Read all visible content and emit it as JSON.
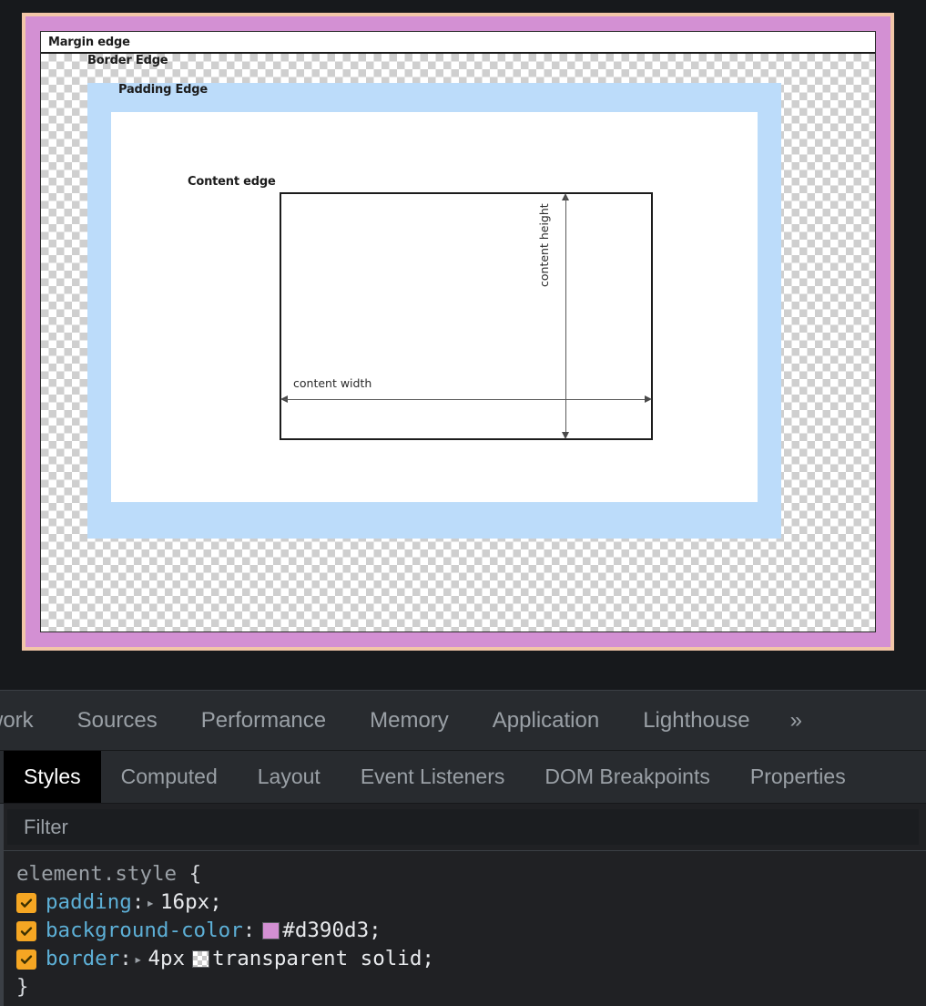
{
  "page": {
    "diagram": {
      "title": "CSS box model diagram",
      "labels": {
        "margin_edge": "Margin edge",
        "border_edge": "Border Edge",
        "padding_edge": "Padding Edge",
        "content_edge": "Content edge",
        "content_width": "content width",
        "content_height": "content height"
      },
      "colors": {
        "element_background": "#d390d3",
        "element_border": "#f2c6a8",
        "padding_region": "#bcdcfa",
        "content_region": "#ffffff",
        "margin_region": "transparent-checkerboard",
        "outline": "#1c1c1c"
      }
    }
  },
  "devtools": {
    "main_tabs": [
      {
        "label": "work",
        "active": false,
        "truncated": true
      },
      {
        "label": "Sources",
        "active": false
      },
      {
        "label": "Performance",
        "active": false
      },
      {
        "label": "Memory",
        "active": false
      },
      {
        "label": "Application",
        "active": false
      },
      {
        "label": "Lighthouse",
        "active": false
      }
    ],
    "overflow_label": "»",
    "sidebar_tabs": [
      {
        "label": "Styles",
        "active": true
      },
      {
        "label": "Computed",
        "active": false
      },
      {
        "label": "Layout",
        "active": false
      },
      {
        "label": "Event Listeners",
        "active": false
      },
      {
        "label": "DOM Breakpoints",
        "active": false
      },
      {
        "label": "Properties",
        "active": false
      }
    ],
    "filter": {
      "placeholder": "Filter",
      "value": ""
    },
    "styles": {
      "selector": "element.style",
      "open_brace": "{",
      "close_brace": "}",
      "declarations": [
        {
          "enabled": true,
          "name": "padding",
          "colon": ":",
          "expandable": true,
          "expand_glyph": "▸",
          "value": "16px;",
          "swatch": null
        },
        {
          "enabled": true,
          "name": "background-color",
          "colon": ":",
          "expandable": false,
          "expand_glyph": "",
          "value": "#d390d3;",
          "swatch": "color",
          "swatch_color": "#d390d3"
        },
        {
          "enabled": true,
          "name": "border",
          "colon": ":",
          "expandable": true,
          "expand_glyph": "▸",
          "value_prefix": "4px",
          "value": "transparent solid;",
          "swatch": "transparent"
        }
      ]
    }
  }
}
